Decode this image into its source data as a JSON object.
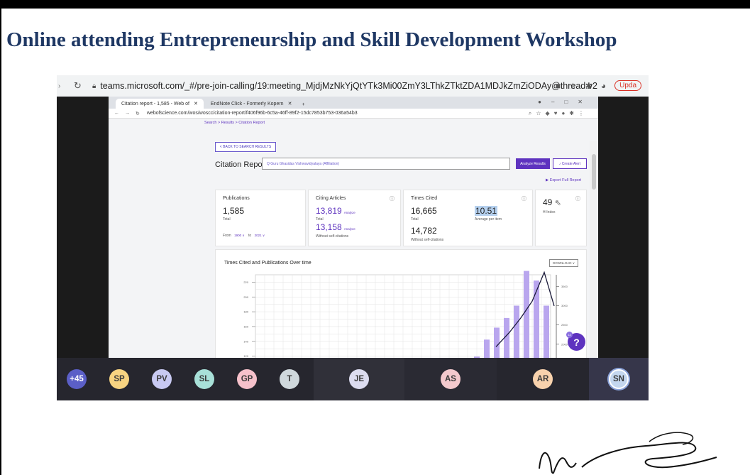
{
  "slide": {
    "title": "Online attending Entrepreneurship and Skill Development Workshop"
  },
  "outer_browser": {
    "url": "teams.microsoft.com/_#/pre-join-calling/19:meeting_MjdjMzNkYjQtYTk3Mi00ZmY3LThkZTktZDA1MDJkZmZiODAy@thread.v2",
    "update_label": "Upda"
  },
  "inner_browser": {
    "tabs": [
      {
        "label": "Citation report - 1,585 - Web of"
      },
      {
        "label": "EndNote Click - Formerly Kopern"
      }
    ],
    "url": "webofscience.com/wos/woscc/citation-report/f406f96b-6c5a-46ff-89f2-15dc7853b753-036a54b3"
  },
  "report": {
    "breadcrumb": "Search > Results > Citation Report",
    "back_label": "< BACK TO SEARCH RESULTS",
    "title": "Citation Report",
    "search_value": "Q  Guru Ghasidas Vishwavidyalaya (Affiliation)",
    "analyze_label": "Analyze Results",
    "alert_label": "♪ Create Alert",
    "export_label": "▶ Export Full Report",
    "publications": {
      "label": "Publications",
      "value": "1,585",
      "sub": "Total",
      "from_label": "From",
      "from_year": "1900 ∨",
      "to_label": "to",
      "to_year": "2021 ∨"
    },
    "citing": {
      "label": "Citing Articles",
      "value": "13,819",
      "analyze": "Analyze",
      "sub": "Total",
      "value2": "13,158",
      "analyze2": "Analyze",
      "sub2": "Without self-citations"
    },
    "times_cited": {
      "label": "Times Cited",
      "value": "16,665",
      "sub": "Total",
      "avg": "10.51",
      "avg_sub": "Average per item",
      "value2": "14,782",
      "sub2": "Without self-citations"
    },
    "h_index": {
      "value": "49",
      "sub": "H-Index"
    },
    "chart_title": "Times Cited and Publications Over time",
    "download_label": "DOWNLOAD ∨"
  },
  "chart_data": {
    "type": "bar",
    "title": "Times Cited and Publications Over time",
    "y_left_ticks": [
      120,
      140,
      160,
      180,
      200,
      220
    ],
    "y_right_ticks": [
      2000,
      2500,
      3000,
      3500
    ],
    "bar_values": [
      18,
      62,
      93,
      118,
      150,
      240,
      215,
      150
    ],
    "line_values": [
      700,
      1300,
      1900,
      2600,
      3800,
      2400
    ],
    "ylim_left": [
      0,
      230
    ],
    "ylim_right": [
      0,
      3700
    ]
  },
  "participants": [
    {
      "initials": "+45",
      "bg": "#5b5fc7",
      "fg": "#ffffff"
    },
    {
      "initials": "SP",
      "bg": "#f8d481",
      "fg": "#3a3a3a"
    },
    {
      "initials": "PV",
      "bg": "#c8c9f2",
      "fg": "#3a3a3a"
    },
    {
      "initials": "SL",
      "bg": "#a8e0d8",
      "fg": "#3a3a3a"
    },
    {
      "initials": "GP",
      "bg": "#f6c1cb",
      "fg": "#3a3a3a"
    },
    {
      "initials": "T",
      "bg": "#cfd8dc",
      "fg": "#3a3a3a"
    },
    {
      "initials": "JE",
      "bg": "#dcdcf0",
      "fg": "#3a3a3a"
    },
    {
      "initials": "AS",
      "bg": "#f3c9cd",
      "fg": "#3a3a3a"
    },
    {
      "initials": "AR",
      "bg": "#f8d2ad",
      "fg": "#3a3a3a"
    },
    {
      "initials": "SN",
      "bg": "#c4d7ef",
      "fg": "#3a3a3a"
    }
  ]
}
